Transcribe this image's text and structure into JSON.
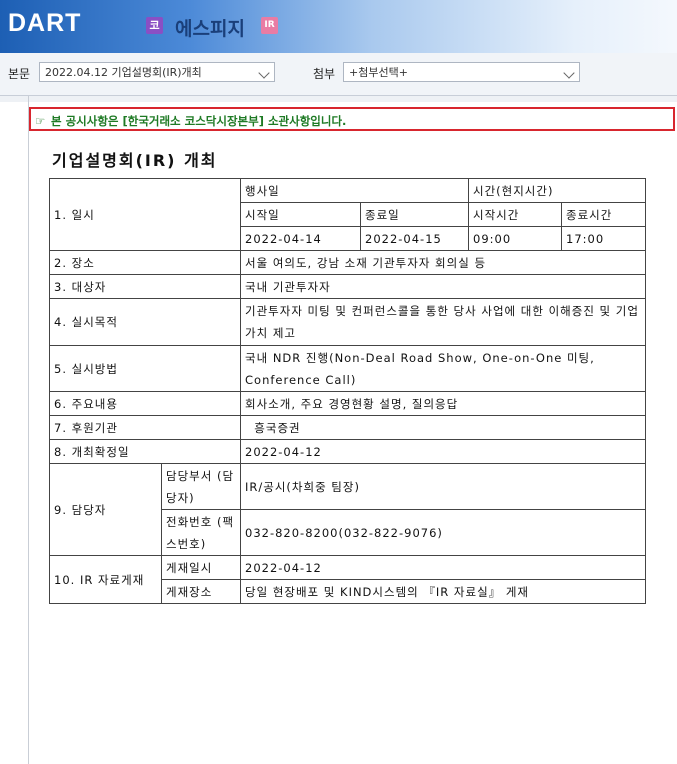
{
  "header": {
    "logo": "DART",
    "market_badge": "코",
    "company": "에스피지",
    "ir_badge": "IR"
  },
  "selector": {
    "body_label": "본문",
    "body_value": "2022.04.12  기업설명회(IR)개최",
    "attach_label": "첨부",
    "attach_value": "+첨부선택+"
  },
  "notice": "본 공시사항은 [한국거래소 코스닥시장본부] 소관사항입니다.",
  "doc_title": "기업설명회(IR) 개최",
  "table": {
    "r1_label": "1. 일시",
    "event_date": "행사일",
    "time_local": "시간(현지시간)",
    "start_date_h": "시작일",
    "end_date_h": "종료일",
    "start_time_h": "시작시간",
    "end_time_h": "종료시간",
    "start_date": "2022-04-14",
    "end_date": "2022-04-15",
    "start_time": "09:00",
    "end_time": "17:00",
    "r2_label": "2. 장소",
    "r2_value": "서울 여의도, 강남 소재 기관투자자 회의실 등",
    "r3_label": "3. 대상자",
    "r3_value": "국내 기관투자자",
    "r4_label": "4. 실시목적",
    "r4_value": "기관투자자 미팅 및 컨퍼런스콜을 통한 당사 사업에 대한 이해증진 및 기업가치 제고",
    "r5_label": "5. 실시방법",
    "r5_value": "  국내 NDR 진행(Non-Deal Road Show, One-on-One 미팅, Conference Call)",
    "r6_label": "6. 주요내용",
    "r6_value": "회사소개, 주요 경영현황 설명, 질의응답",
    "r7_label": "7. 후원기관",
    "r7_value": "  흥국증권",
    "r8_label": "8. 개최확정일",
    "r8_value": "2022-04-12",
    "r9_label": "9. 담당자",
    "r9_dept_h": "담당부서 (담당자)",
    "r9_dept": "IR/공시(차희중 팀장)",
    "r9_tel_h": "전화번호 (팩스번호)",
    "r9_tel": "032-820-8200(032-822-9076)",
    "r10_label": "10. IR 자료게재",
    "r10_date_h": "게재일시",
    "r10_date": "2022-04-12",
    "r10_place_h": "게재장소",
    "r10_place": "당일 현장배포 및 KIND시스템의 『IR 자료실』 게재"
  },
  "colors": {
    "accent": "#1d5fb4",
    "notice_border": "#d8262e",
    "notice_text": "#1e7a24"
  },
  "icons": [
    "logo-icon",
    "hand-pointer-icon",
    "chevron-down-icon"
  ]
}
